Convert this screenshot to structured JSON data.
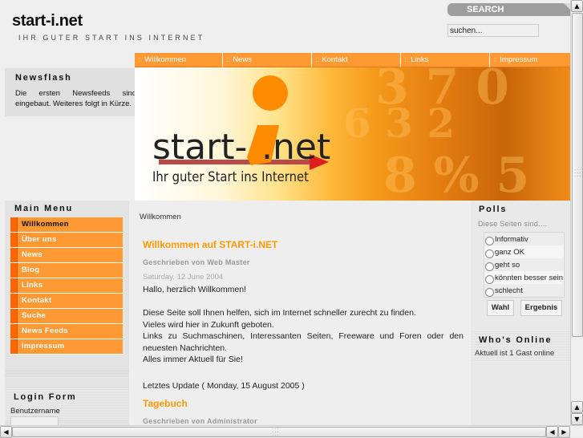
{
  "header": {
    "site_title": "start-i.net",
    "slogan": "IHR GUTER START INS INTERNET"
  },
  "search": {
    "label": "SEARCH",
    "placeholder": "suchen..."
  },
  "topnav": {
    "separator": "::",
    "items": [
      {
        "label": "Willkommen"
      },
      {
        "label": "News"
      },
      {
        "label": "Kontakt"
      },
      {
        "label": "Links"
      },
      {
        "label": "Impressum"
      }
    ]
  },
  "newsflash": {
    "title": "Newsflash",
    "text": "Die ersten Newsfeeds sind eingebaut. Weiteres folgt in Kürze."
  },
  "banner": {
    "logo_text_start": "start-",
    "logo_text_net": ".net",
    "logo_tagline": "Ihr guter Start ins Internet",
    "colors": {
      "orange": "#ff8c00",
      "red_arrow": "#e02020"
    }
  },
  "main_menu": {
    "title": "Main Menu",
    "active_index": 0,
    "items": [
      {
        "label": "Willkommen"
      },
      {
        "label": "Über uns"
      },
      {
        "label": "News"
      },
      {
        "label": "Blog"
      },
      {
        "label": "Links"
      },
      {
        "label": "Kontakt"
      },
      {
        "label": "Suche"
      },
      {
        "label": "News Feeds"
      },
      {
        "label": "Impressum"
      }
    ]
  },
  "login": {
    "title": "Login Form",
    "username_label": "Benutzername",
    "username_value": ""
  },
  "content": {
    "breadcrumb": "Willkommen",
    "articles": [
      {
        "title": "Willkommen auf START-i.NET",
        "author": "Geschrieben von Web Master",
        "date": "Saturday, 12 June 2004",
        "greeting": "Hallo, herzlich Willkommen!",
        "paragraph": [
          "Diese Seite soll Ihnen helfen, sich im Internet schneller zurecht zu finden.",
          "Vieles wird hier in Zukunft geboten.",
          "Links zu Suchmaschinen, Interessanten Seiten, Freeware und Foren oder den neuesten Nachrichten.",
          "Alles immer Aktuell für Sie!"
        ],
        "last_update": "Letztes Update ( Monday, 15 August 2005 )"
      },
      {
        "title": "Tagebuch",
        "author": "Geschrieben von Administrator"
      }
    ]
  },
  "polls": {
    "title": "Polls",
    "question": "Diese Seiten sind....",
    "options": [
      {
        "label": "Informativ",
        "selected": false
      },
      {
        "label": "ganz OK",
        "selected": false
      },
      {
        "label": "geht so",
        "selected": false
      },
      {
        "label": "könnten besser sein",
        "selected": false
      },
      {
        "label": "schlecht",
        "selected": false
      }
    ],
    "vote_label": "Wahl",
    "results_label": "Ergebnis"
  },
  "whos_online": {
    "title": "Who's Online",
    "text": "Aktuell ist 1 Gast online"
  },
  "scrollbars": {
    "vertical_position": 0.0,
    "horizontal_position": 0.0
  },
  "colors": {
    "accent_orange": "#ff9933",
    "menu_bar_orange": "#ff6600",
    "article_title": "#ff9900",
    "background": "#efefef"
  }
}
